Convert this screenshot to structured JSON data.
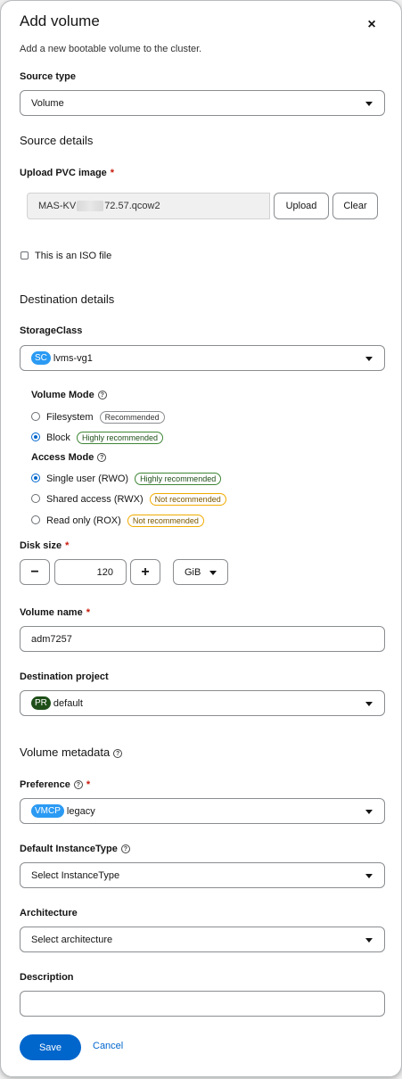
{
  "modal": {
    "title": "Add volume",
    "subtitle": "Add a new bootable volume to the cluster.",
    "close_glyph": "×"
  },
  "source_type": {
    "label": "Source type",
    "value": "Volume"
  },
  "source_details": {
    "heading": "Source details",
    "upload_label": "Upload PVC image",
    "required_mark": "*",
    "file_prefix": "MAS-KV",
    "file_suffix": "72.57.qcow2",
    "upload_button": "Upload",
    "clear_button": "Clear",
    "iso_checkbox_label": "This is an ISO file"
  },
  "destination_details": {
    "heading": "Destination details",
    "storage_class_label": "StorageClass",
    "storage_class_badge": "SC",
    "storage_class_value": "lvms-vg1",
    "volume_mode_label": "Volume Mode",
    "volume_mode_options": [
      {
        "label": "Filesystem",
        "tag": "Recommended",
        "selected": false
      },
      {
        "label": "Block",
        "tag": "Highly recommended",
        "selected": true
      }
    ],
    "access_mode_label": "Access Mode",
    "access_mode_options": [
      {
        "label": "Single user (RWO)",
        "tag": "Highly recommended",
        "selected": true
      },
      {
        "label": "Shared access (RWX)",
        "tag": "Not recommended",
        "selected": false
      },
      {
        "label": "Read only (ROX)",
        "tag": "Not recommended",
        "selected": false
      }
    ],
    "disk_size_label": "Disk size",
    "disk_size_value": "120",
    "minus_glyph": "−",
    "plus_glyph": "+",
    "disk_unit": "GiB",
    "volume_name_label": "Volume name",
    "volume_name_value": "adm7257",
    "project_label": "Destination project",
    "project_badge": "PR",
    "project_value": "default"
  },
  "volume_metadata": {
    "heading": "Volume metadata",
    "preference_label": "Preference",
    "preference_badge": "VMCP",
    "preference_value": "legacy",
    "instancetype_label": "Default InstanceType",
    "instancetype_placeholder": "Select InstanceType",
    "architecture_label": "Architecture",
    "architecture_placeholder": "Select architecture",
    "description_label": "Description",
    "description_value": ""
  },
  "help_glyph": "?",
  "footer": {
    "save": "Save",
    "cancel": "Cancel"
  },
  "colors": {
    "primary": "#0066cc",
    "sc_badge": "#2b9af3",
    "pr_badge": "#1e4f18",
    "vmcp_badge": "#2b9af3",
    "required": "#c9190b"
  }
}
